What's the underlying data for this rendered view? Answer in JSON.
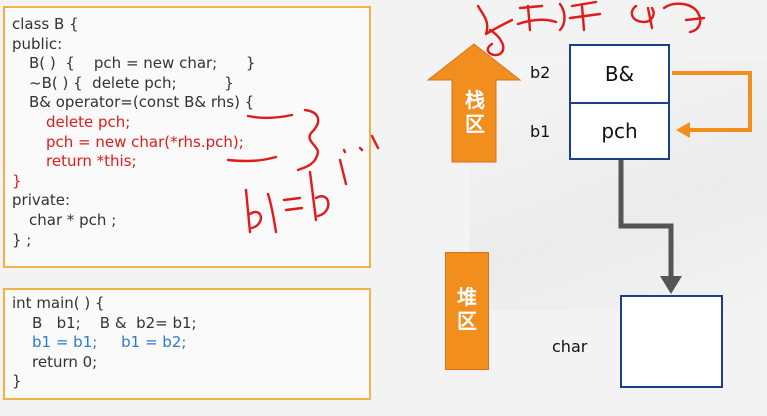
{
  "class_code": [
    {
      "text": "class B {",
      "indent": 0,
      "color": "dark"
    },
    {
      "text": "public:",
      "indent": 0,
      "color": "dark"
    },
    {
      "text": "B( )  {    pch = new char;      }",
      "indent": 1,
      "color": "dark"
    },
    {
      "text": "~B( ) {  delete pch;          }",
      "indent": 1,
      "color": "dark"
    },
    {
      "text": "B& operator=(const B& rhs) {",
      "indent": 1,
      "color": "dark"
    },
    {
      "text": "delete pch;",
      "indent": 2,
      "color": "red"
    },
    {
      "text": "pch = new char(*rhs.pch);",
      "indent": 2,
      "color": "red"
    },
    {
      "text": "return *this;",
      "indent": 2,
      "color": "red"
    },
    {
      "text": "}",
      "indent": 0,
      "color": "red"
    },
    {
      "text": "private:",
      "indent": 0,
      "color": "dark"
    },
    {
      "text": "char * pch ;",
      "indent": 1,
      "color": "dark"
    },
    {
      "text": "} ;",
      "indent": 0,
      "color": "dark"
    }
  ],
  "main_code": [
    {
      "text": "int main( ) {",
      "indent": 0,
      "color": "dark"
    },
    {
      "text": "B   b1;    B &  b2= b1;",
      "indent": 1,
      "color": "dark"
    },
    {
      "text": "b1 = b1;     b1 = b2;",
      "indent": 1,
      "color": "blue"
    },
    {
      "text": "return 0;",
      "indent": 1,
      "color": "dark"
    },
    {
      "text": "}",
      "indent": 0,
      "color": "dark"
    }
  ],
  "stack_label": "栈\n区",
  "heap_label": "堆\n区",
  "stack_cells": {
    "top_text": "B&",
    "bottom_text": "pch"
  },
  "labels": {
    "b2": "b2",
    "b1": "b1",
    "char": "char"
  },
  "colors": {
    "orange": "#f28e1e",
    "box_border": "#1d3f88",
    "code_border": "#f2b24a",
    "arrow_gray": "#555555",
    "code_red": "#e01b1b",
    "code_blue": "#2a7bd6"
  }
}
